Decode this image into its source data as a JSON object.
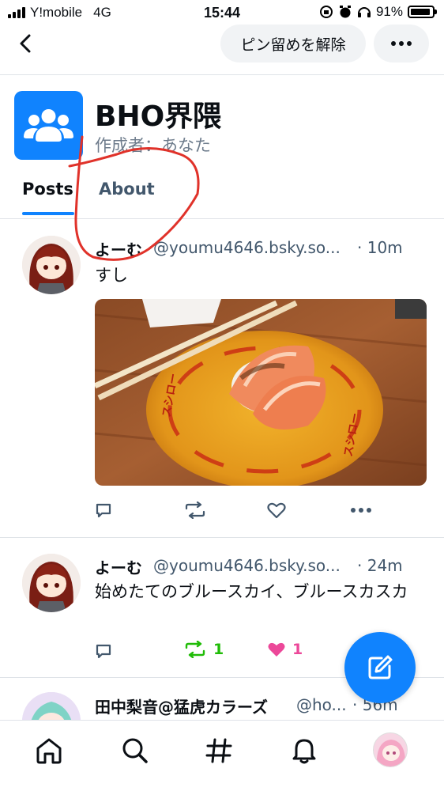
{
  "status_bar": {
    "carrier": "Y!mobile",
    "network": "4G",
    "time": "15:44",
    "battery": "91%",
    "battery_level": 0.91
  },
  "header": {
    "unpin_label": "ピン留めを解除"
  },
  "feed": {
    "title": "BHO界隈",
    "creator": "作成者：あなた",
    "tabs": [
      "Posts",
      "About"
    ],
    "active_tab": "Posts"
  },
  "posts": [
    {
      "name": "よーむ",
      "handle": "@youmu4646.bsky.so...",
      "time": "· 10m",
      "text": "すし",
      "has_image": true,
      "image_desc": "sushi-plate-image",
      "plate_text": "スシロー",
      "reposts": "",
      "likes": ""
    },
    {
      "name": "よーむ",
      "handle": "@youmu4646.bsky.so...",
      "time": "· 24m",
      "text": "始めたてのブルースカイ、ブルースカスカ",
      "has_image": false,
      "reposts": "1",
      "likes": "1"
    },
    {
      "name": "田中梨音@猛虎カラーズ",
      "handle": "@ho...",
      "time": "· 56m"
    }
  ],
  "colors": {
    "accent": "#1083fe",
    "muted": "#42576c",
    "repost": "#20bc07",
    "like": "#ec4899"
  }
}
